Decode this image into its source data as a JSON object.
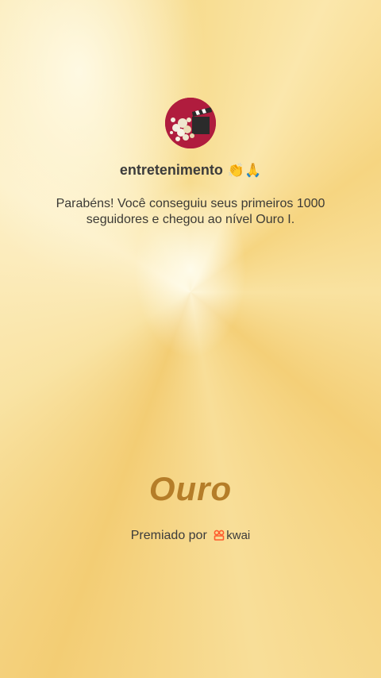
{
  "achievement": {
    "username": "entretenimento",
    "username_emojis": "👏🙏",
    "message_line1": "Parabéns! Você conseguiu seus primeiros 1000",
    "message_line2": "seguidores e chegou ao nível Ouro I.",
    "level": "Ouro",
    "awarded_by_label": "Premiado por",
    "brand_name": "kwai"
  },
  "colors": {
    "background": "#f7d98a",
    "level_text": "#b57d28",
    "brand_accent": "#ff5a2c",
    "avatar_bg": "#b01c3e"
  },
  "icons": {
    "avatar": "popcorn-clapperboard-avatar",
    "brand": "kwai-logo-icon"
  }
}
